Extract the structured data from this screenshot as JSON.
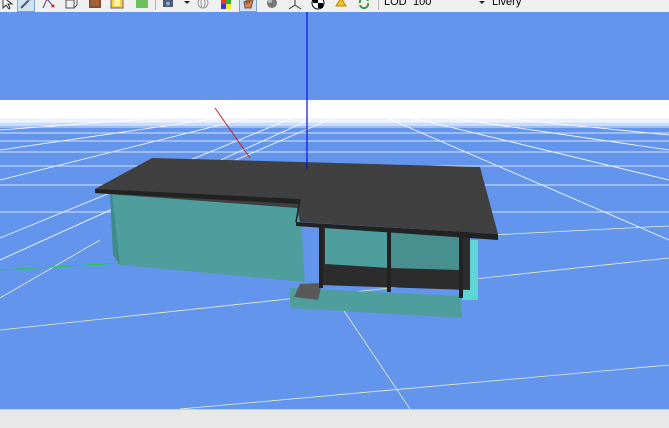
{
  "toolbar": {
    "lod_label": "LOD",
    "lod_value": "100",
    "livery_label": "Livery",
    "icons": [
      "select-arrow-icon",
      "edit-wand-icon",
      "edit-points-icon",
      "box-wireframe-icon",
      "texture-icon",
      "material-icon",
      "solid-shade-icon",
      "camera-icon",
      "mesh-sphere-icon",
      "color-cube-icon",
      "hand-icon",
      "sphere-icon",
      "axis-icon",
      "checker-icon",
      "light-icon",
      "refresh-icon"
    ]
  },
  "viewport": {
    "background_color": "#6495ed",
    "grid_color": "#ffffff",
    "roof_color": "#404040",
    "wall_color": "#4f9e9e"
  }
}
